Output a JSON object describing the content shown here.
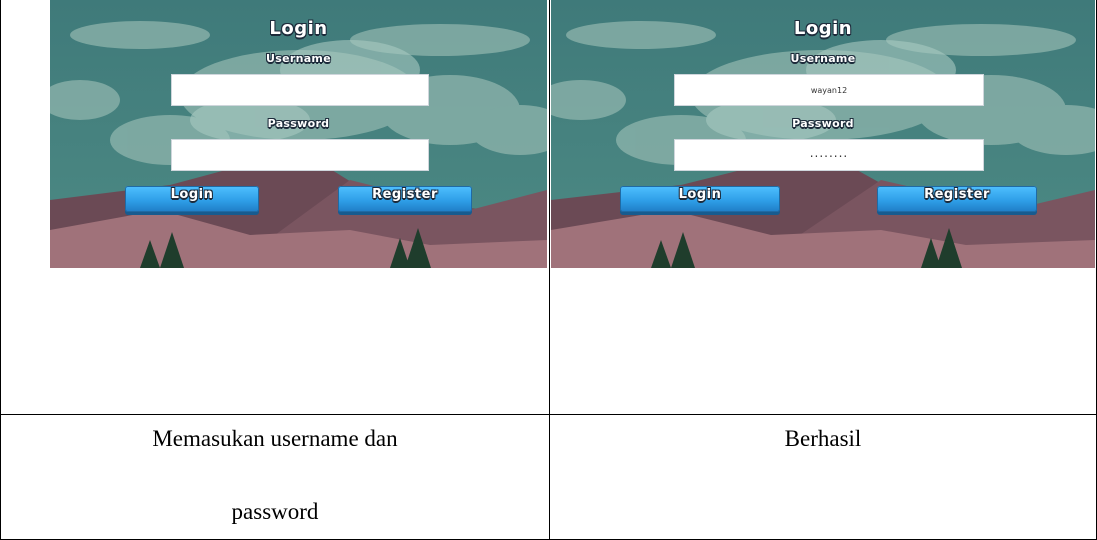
{
  "left_screen": {
    "title": "Login",
    "username_label": "Username",
    "username_value": "",
    "password_label": "Password",
    "password_value": "",
    "login_button": "Login",
    "register_button": "Register"
  },
  "right_screen": {
    "title": "Login",
    "username_label": "Username",
    "username_value": "wayan12",
    "password_label": "Password",
    "password_value": "........",
    "login_button": "Login",
    "register_button": "Register"
  },
  "captions": {
    "left_line1": "Memasukan username dan",
    "left_line2": "password",
    "right": "Berhasil"
  }
}
